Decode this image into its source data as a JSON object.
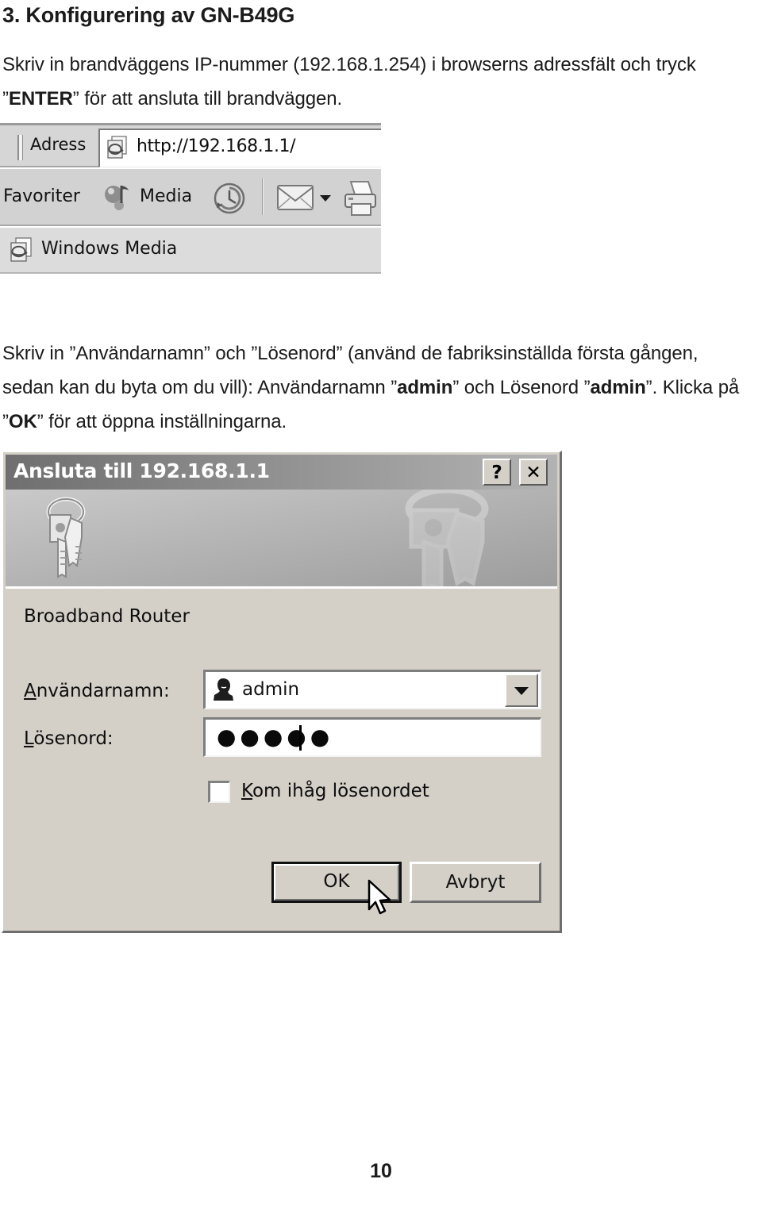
{
  "document": {
    "heading": "3. Konfigurering av GN-B49G",
    "intro_paragraph_html": "Skriv in brandväggens IP-nummer (192.168.1.254) i browserns adressfält och tryck ”<b>ENTER</b>” för att ansluta till brandväggen.",
    "login_paragraph_html": "Skriv in ”Användarnamn” och ”Lösenord” (använd de fabriksinställda första gången, sedan kan du byta om du vill): Användarnamn ”<b>admin</b>” och Lösenord ”<b>admin</b>”. Klicka på ”<b>OK</b>” för att öppna inställningarna.",
    "page_number": "10"
  },
  "browser_screenshot": {
    "address_label": "Adress",
    "address_url": "http://192.168.1.1/",
    "address_icon": "ie-document-icon",
    "toolbar": {
      "favorites_label": "Favoriter",
      "media_label": "Media",
      "media_icon": "media-ball-icon",
      "history_icon": "history-clock-icon",
      "mail_icon": "mail-envelope-icon",
      "mail_dropdown_icon": "chevron-down-icon",
      "print_icon": "printer-icon"
    },
    "links_bar": {
      "icon": "ie-document-icon",
      "label": "Windows Media"
    }
  },
  "auth_dialog": {
    "title": "Ansluta till 192.168.1.1",
    "help_button": "?",
    "close_button": "✕",
    "banner_icon": "keyring-icon",
    "banner_watermark_icon": "keyring-watermark-icon",
    "realm_label": "Broadband Router",
    "username": {
      "label_prefix": "A",
      "label_rest": "nvändarnamn:",
      "value": "admin",
      "icon": "user-avatar-icon",
      "dropdown_icon": "chevron-down-icon"
    },
    "password": {
      "label_prefix": "L",
      "label_rest": "ösenord:",
      "masked_value": "●●●●●"
    },
    "remember": {
      "label_prefix": "K",
      "label_rest": "om ihåg lösenordet",
      "checked": false
    },
    "ok_button": "OK",
    "cancel_button": "Avbryt",
    "cursor_icon": "mouse-pointer-icon"
  },
  "colors": {
    "dialog_face": "#d4d0c8",
    "titlebar_dark": "#6f6f6f",
    "titlebar_light": "#b3b3b3",
    "text": "#1b1b1b",
    "field_bg": "#ffffff"
  }
}
